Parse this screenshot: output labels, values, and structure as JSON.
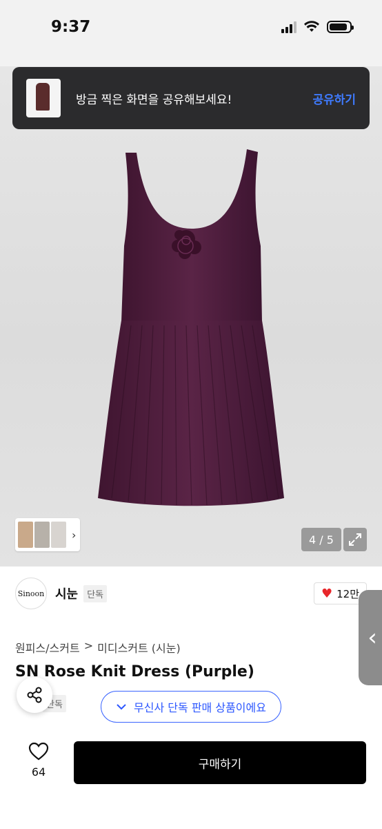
{
  "status_bar": {
    "time": "9:37"
  },
  "share_toast": {
    "message": "방금 찍은 화면을 공유해보세요!",
    "action": "공유하기"
  },
  "gallery": {
    "counter": "4 / 5",
    "current": 4,
    "total": 5
  },
  "brand": {
    "logo_text": "Sinoon",
    "name": "시눈",
    "badge": "단독"
  },
  "likes": {
    "count": "12만"
  },
  "breadcrumb": {
    "category": "원피스/스커트",
    "separator": ">",
    "subcategory": "미디스커트 (시눈)"
  },
  "product": {
    "title": "SN Rose Knit Dress (Purple)",
    "badge": "단독"
  },
  "exclusive_notice": "무신사 단독 판매 상품이에요",
  "bottom_bar": {
    "wish_count": "64",
    "buy_label": "구매하기"
  },
  "colors": {
    "dress": "#4e1d3b",
    "accent_blue": "#2c57ff",
    "heart": "#e8262a"
  }
}
